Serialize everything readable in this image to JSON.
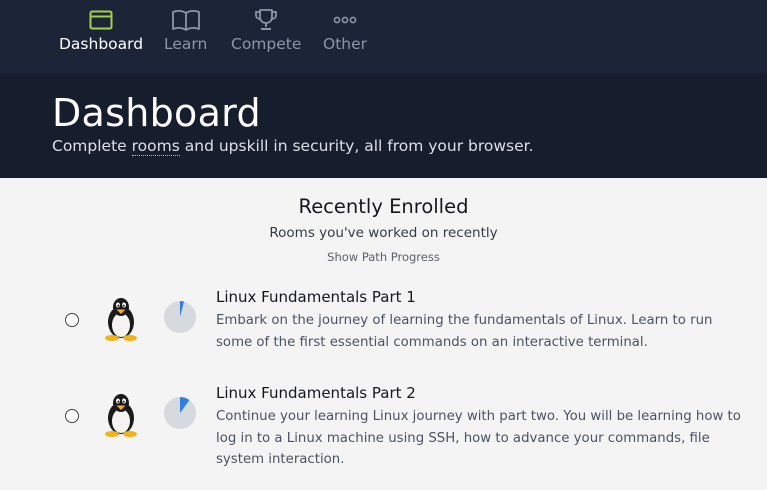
{
  "nav": {
    "items": [
      {
        "label": "Dashboard",
        "icon": "dashboard-icon",
        "active": true
      },
      {
        "label": "Learn",
        "icon": "book-icon",
        "active": false
      },
      {
        "label": "Compete",
        "icon": "trophy-icon",
        "active": false
      },
      {
        "label": "Other",
        "icon": "more-dots-icon",
        "active": false
      }
    ]
  },
  "hero": {
    "title": "Dashboard",
    "subtitle_before": "Complete ",
    "subtitle_link": "rooms",
    "subtitle_after": " and upskill in security, all from your browser."
  },
  "recent": {
    "title": "Recently Enrolled",
    "subtitle": "Rooms you've worked on recently",
    "path_link": "Show Path Progress",
    "rooms": [
      {
        "title": "Linux Fundamentals Part 1",
        "description": "Embark on the journey of learning the fundamentals of Linux. Learn to run some of the first essential commands on an interactive terminal.",
        "progress": 0.04,
        "icon": "tux-penguin-icon"
      },
      {
        "title": "Linux Fundamentals Part 2",
        "description": "Continue your learning Linux journey with part two. You will be learning how to log in to a Linux machine using SSH, how to advance your commands, file system interaction.",
        "progress": 0.1,
        "icon": "tux-penguin-icon"
      }
    ]
  },
  "colors": {
    "nav_bg": "#1c2538",
    "hero_bg": "#161d2c",
    "accent_green": "#a3d04a",
    "progress_blue": "#2e7fe0",
    "progress_track": "#d6d9de"
  }
}
